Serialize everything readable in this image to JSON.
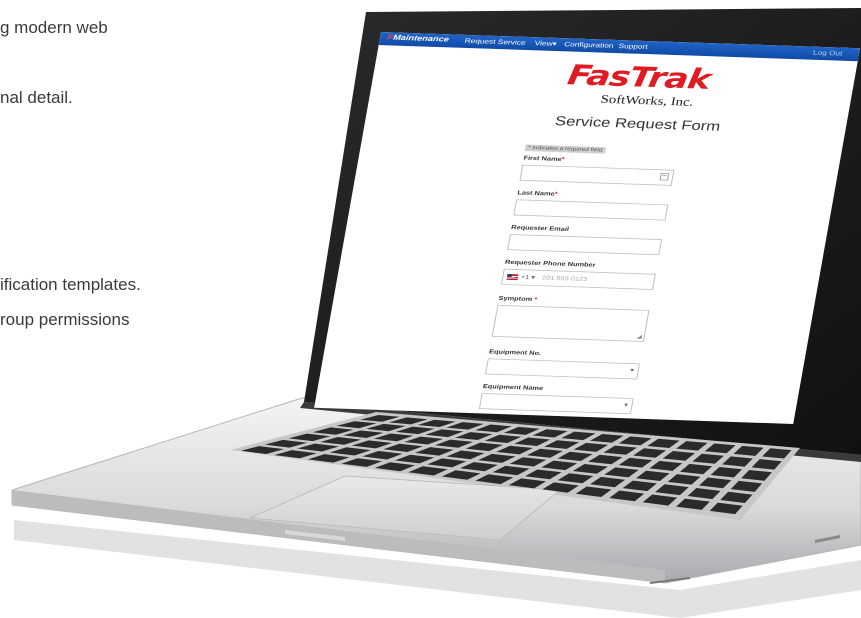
{
  "background_text": [
    "g modern web",
    "nal detail.",
    "ification templates.",
    "roup permissions"
  ],
  "navbar": {
    "brand_prefix": "F",
    "brand": "Maintenance",
    "items": [
      "Request Service",
      "View▾",
      "Configuration",
      "Support"
    ],
    "logout": "Log Out",
    "color": "#1a5cc0"
  },
  "logo": {
    "name": "FasTrak",
    "sub": "SoftWorks, Inc.",
    "color": "#e01b22"
  },
  "form": {
    "title": "Service Request Form",
    "required_note": "* indicates a required field",
    "fields": {
      "first_name": {
        "label": "First Name",
        "required_mark": "*"
      },
      "last_name": {
        "label": "Last Name",
        "required_mark": "*"
      },
      "requester_email": {
        "label": "Requester Email"
      },
      "requester_phone": {
        "label": "Requester Phone Number",
        "country_code": "+1 ▾",
        "placeholder": "201 555 0123"
      },
      "symptom": {
        "label": "Symptom",
        "required_mark": "*"
      },
      "equipment_no": {
        "label": "Equipment No."
      },
      "equipment_name": {
        "label": "Equipment Name"
      }
    }
  },
  "icons": [
    "calendar-icon",
    "us-flag-icon",
    "chevron-down-icon",
    "resize-grip-icon"
  ]
}
